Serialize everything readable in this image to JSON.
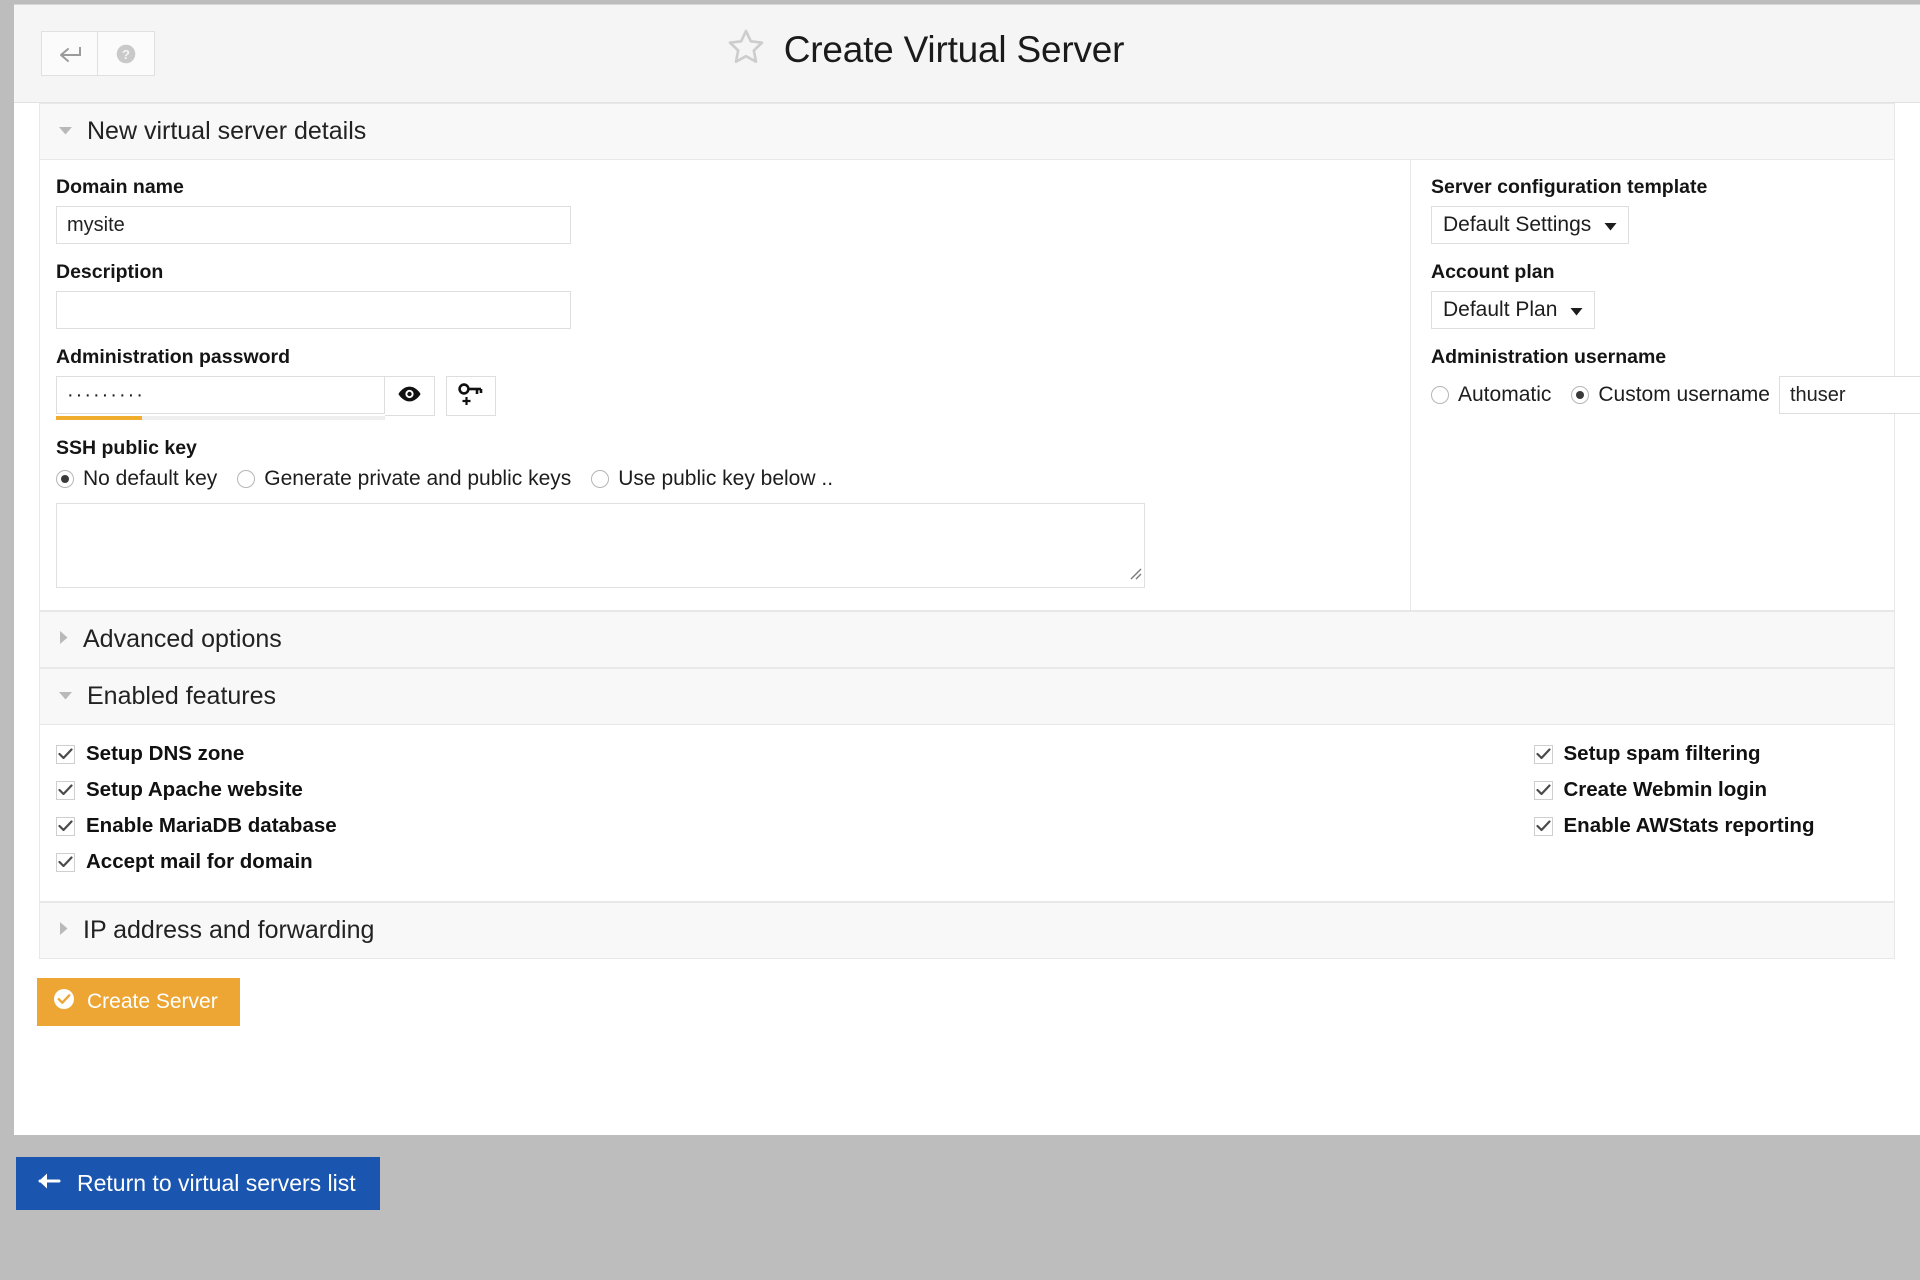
{
  "header": {
    "back_icon": "return-arrow-icon",
    "help_icon": "question-circle-icon",
    "star_icon": "star-outline-icon",
    "title": "Create Virtual Server"
  },
  "sections": {
    "details": {
      "label": "New virtual server details",
      "expanded": true,
      "toggle_icon": "triangle-down-icon"
    },
    "advanced": {
      "label": "Advanced options",
      "expanded": false,
      "toggle_icon": "triangle-right-icon"
    },
    "features": {
      "label": "Enabled features",
      "expanded": true,
      "toggle_icon": "triangle-down-icon"
    },
    "ip": {
      "label": "IP address and forwarding",
      "expanded": false,
      "toggle_icon": "triangle-right-icon"
    }
  },
  "form": {
    "domain": {
      "label": "Domain name",
      "value": "mysite",
      "placeholder": ""
    },
    "description": {
      "label": "Description",
      "value": "",
      "placeholder": ""
    },
    "password": {
      "label": "Administration password",
      "value": "·········",
      "strength_percent": 26,
      "strength_color": "#f0ad2e",
      "show_icon": "eye-icon",
      "generate_icon": "key-plus-icon"
    },
    "ssh": {
      "label": "SSH public key",
      "options": [
        {
          "label": "No default key",
          "selected": true
        },
        {
          "label": "Generate private and public keys",
          "selected": false
        },
        {
          "label": "Use public key below ..",
          "selected": false
        }
      ],
      "textarea_value": "",
      "textarea_placeholder": ""
    },
    "template": {
      "label": "Server configuration template",
      "value": "Default Settings",
      "caret_icon": "caret-down-icon"
    },
    "plan": {
      "label": "Account plan",
      "value": "Default Plan",
      "caret_icon": "caret-down-icon"
    },
    "username": {
      "label": "Administration username",
      "options": [
        {
          "label": "Automatic",
          "selected": false
        },
        {
          "label": "Custom username",
          "selected": true
        }
      ],
      "value": "thuser",
      "placeholder": ""
    }
  },
  "features": {
    "left": [
      {
        "label": "Setup DNS zone",
        "checked": true
      },
      {
        "label": "Setup Apache website",
        "checked": true
      },
      {
        "label": "Enable MariaDB database",
        "checked": true
      },
      {
        "label": "Accept mail for domain",
        "checked": true
      }
    ],
    "right": [
      {
        "label": "Setup spam filtering",
        "checked": true
      },
      {
        "label": "Create Webmin login",
        "checked": true
      },
      {
        "label": "Enable AWStats reporting",
        "checked": true
      }
    ]
  },
  "actions": {
    "create": {
      "label": "Create Server",
      "icon": "check-circle-icon",
      "color": "#eda634"
    },
    "return": {
      "label": "Return to virtual servers list",
      "icon": "arrow-left-icon",
      "color": "#1a55b0"
    }
  }
}
